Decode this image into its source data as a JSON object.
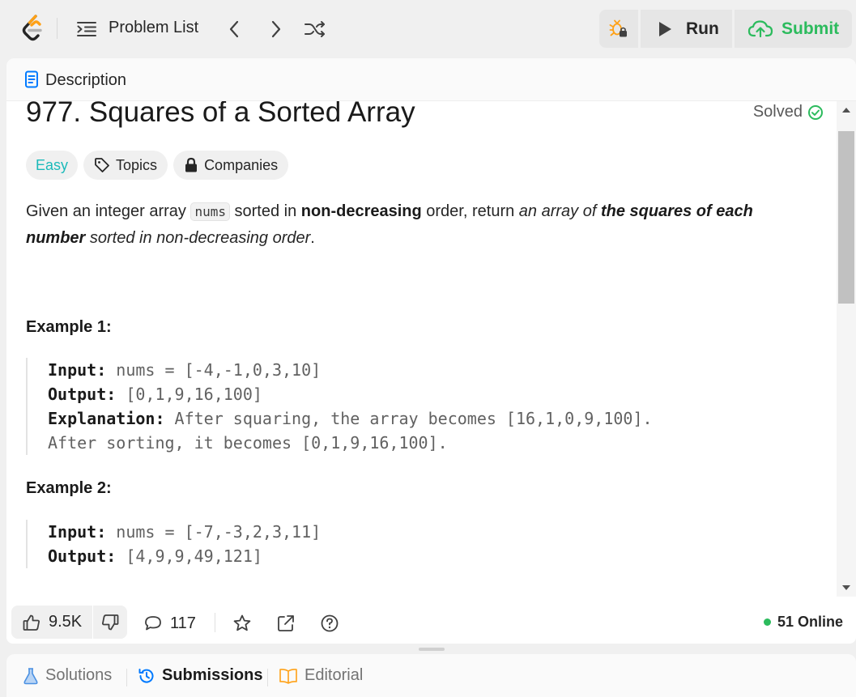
{
  "topbar": {
    "problem_list_label": "Problem List",
    "run_label": "Run",
    "submit_label": "Submit"
  },
  "panel": {
    "tab_label": "Description",
    "title": "977. Squares of a Sorted Array",
    "solved_label": "Solved",
    "tags": {
      "difficulty": "Easy",
      "topics": "Topics",
      "companies": "Companies"
    },
    "description": {
      "t1": "Given an integer array ",
      "code": "nums",
      "t2": " sorted in ",
      "b1": "non-decreasing",
      "t3": " order, return ",
      "i1": "an array of ",
      "bi1": "the squares of each number",
      "i2": " sorted in non-decreasing order",
      "t4": "."
    },
    "examples": [
      {
        "title": "Example 1:",
        "input_label": "Input:",
        "input_value": " nums = [-4,-1,0,3,10]",
        "output_label": "Output:",
        "output_value": " [0,1,9,16,100]",
        "explanation_label": "Explanation:",
        "explanation_value": " After squaring, the array becomes [16,1,0,9,100].",
        "explanation_cont": "After sorting, it becomes [0,1,9,16,100]."
      },
      {
        "title": "Example 2:",
        "input_label": "Input:",
        "input_value": " nums = [-7,-3,2,3,11]",
        "output_label": "Output:",
        "output_value": " [4,9,9,49,121]"
      }
    ]
  },
  "footer": {
    "likes": "9.5K",
    "comments": "117",
    "online": "51 Online"
  },
  "bottom_tabs": {
    "solutions": "Solutions",
    "submissions": "Submissions",
    "editorial": "Editorial"
  },
  "colors": {
    "accent_green": "#2cbb5d",
    "easy_teal": "#1cbaba",
    "logo_orange": "#ffa116",
    "icon_blue": "#007aff"
  }
}
